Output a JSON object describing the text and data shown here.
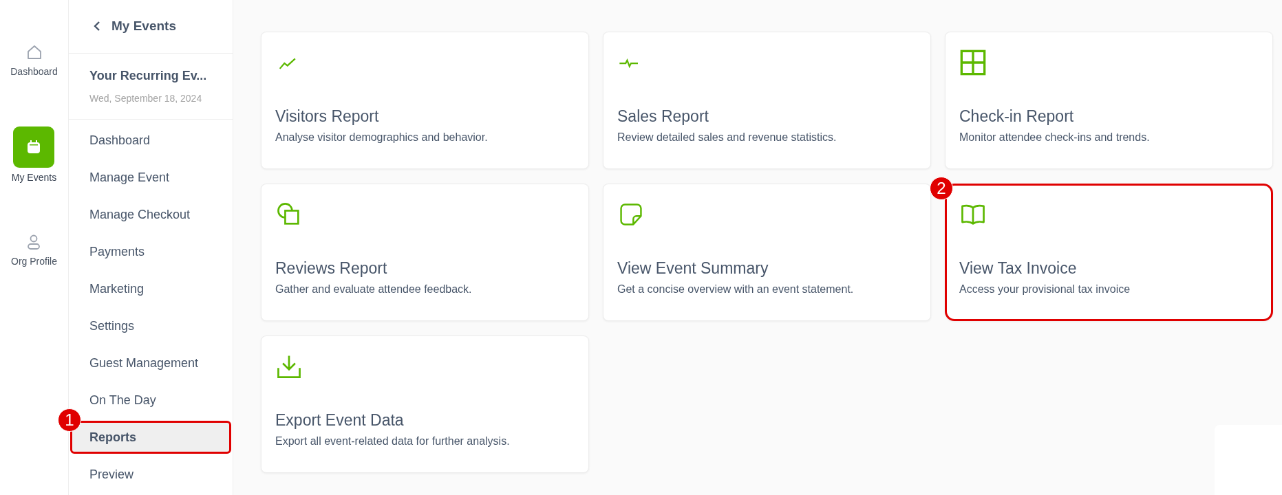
{
  "rail": [
    {
      "label": "Dashboard",
      "selected": false
    },
    {
      "label": "My Events",
      "selected": true
    },
    {
      "label": "Org Profile",
      "selected": false
    }
  ],
  "sidebar": {
    "back_label": "My Events",
    "event_title": "Your Recurring Ev...",
    "event_date": "Wed, September 18, 2024",
    "items": [
      {
        "label": "Dashboard",
        "selected": false
      },
      {
        "label": "Manage Event",
        "selected": false
      },
      {
        "label": "Manage Checkout",
        "selected": false
      },
      {
        "label": "Payments",
        "selected": false
      },
      {
        "label": "Marketing",
        "selected": false
      },
      {
        "label": "Settings",
        "selected": false
      },
      {
        "label": "Guest Management",
        "selected": false
      },
      {
        "label": "On The Day",
        "selected": false
      },
      {
        "label": "Reports",
        "selected": true,
        "callout": "1"
      },
      {
        "label": "Preview",
        "selected": false
      }
    ]
  },
  "cards": [
    {
      "title": "Visitors Report",
      "description": "Analyse visitor demographics and behavior."
    },
    {
      "title": "Sales Report",
      "description": "Review detailed sales and revenue statistics."
    },
    {
      "title": "Check-in Report",
      "description": "Monitor attendee check-ins and trends."
    },
    {
      "title": "Reviews Report",
      "description": "Gather and evaluate attendee feedback."
    },
    {
      "title": "View Event Summary",
      "description": "Get a concise overview with an event statement."
    },
    {
      "title": "View Tax Invoice",
      "description": "Access your provisional tax invoice",
      "callout": "2"
    },
    {
      "title": "Export Event Data",
      "description": "Export all event-related data for further analysis."
    }
  ]
}
